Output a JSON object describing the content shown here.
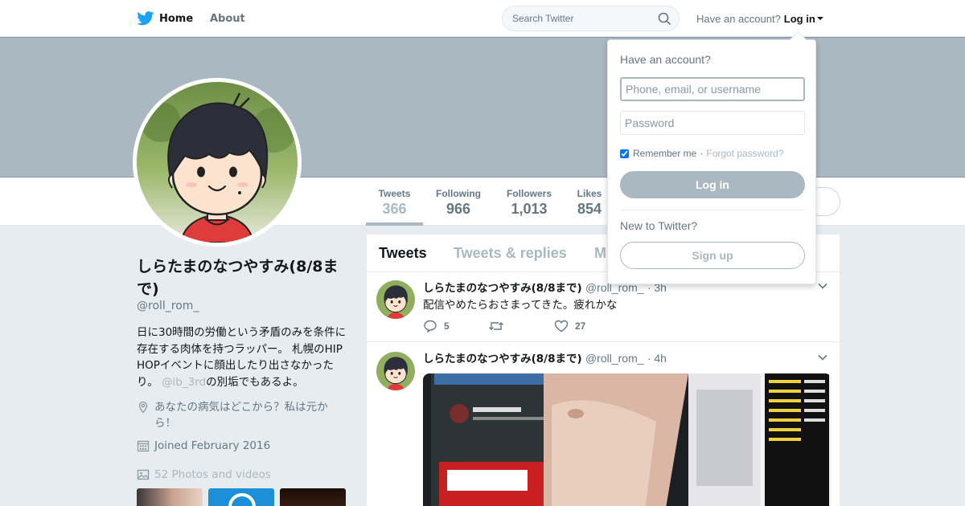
{
  "topnav": {
    "home_label": "Home",
    "about_label": "About",
    "search_placeholder": "Search Twitter",
    "have_account": "Have an account?",
    "login_label": "Log in"
  },
  "profile": {
    "name": "しらたまのなつやすみ(8/8まで)",
    "handle": "@roll_rom_",
    "bio_before": "日に30時間の労働という矛盾のみを条件に存在する肉体を持つラッパー。 札幌のHIP HOPイベントに顔出したり出さなかったり。",
    "bio_mention": "@ib_3rd",
    "bio_after": "の別垢でもあるよ。",
    "location": "あなたの病気はどこから？私は元から！",
    "joined": "Joined February 2016",
    "photos": "52 Photos and videos"
  },
  "stats": [
    {
      "label": "Tweets",
      "value": "366"
    },
    {
      "label": "Following",
      "value": "966"
    },
    {
      "label": "Followers",
      "value": "1,013"
    },
    {
      "label": "Likes",
      "value": "854"
    }
  ],
  "timeline_tabs": [
    {
      "label": "Tweets"
    },
    {
      "label": "Tweets & replies"
    },
    {
      "label": "M"
    }
  ],
  "tweets": [
    {
      "name": "しらたまのなつやすみ(8/8まで)",
      "handle": "@roll_rom_",
      "time": "· 3h",
      "text": "配信やめたらおさまってきた。疲れかな",
      "replies": "5",
      "retweets": "",
      "likes": "27"
    },
    {
      "name": "しらたまのなつやすみ(8/8まで)",
      "handle": "@roll_rom_",
      "time": "· 4h",
      "text": ""
    }
  ],
  "login_dropdown": {
    "title": "Have an account?",
    "username_placeholder": "Phone, email, or username",
    "password_placeholder": "Password",
    "remember_label": "Remember me",
    "separator": "·",
    "forgot_label": "Forgot password?",
    "login_button": "Log in",
    "new_label": "New to Twitter?",
    "signup_button": "Sign up"
  },
  "icons": {
    "brand": "twitter-bird-icon",
    "search": "search-icon",
    "location": "location-pin-icon",
    "calendar": "calendar-icon",
    "photos": "image-icon",
    "reply": "reply-icon",
    "retweet": "retweet-icon",
    "like": "heart-icon",
    "more": "chevron-down-icon"
  },
  "colors": {
    "brand_blue": "#1da1f2",
    "banner": "#aab8c2",
    "muted_accent": "#aab8c2",
    "background": "#e6ecf0"
  }
}
